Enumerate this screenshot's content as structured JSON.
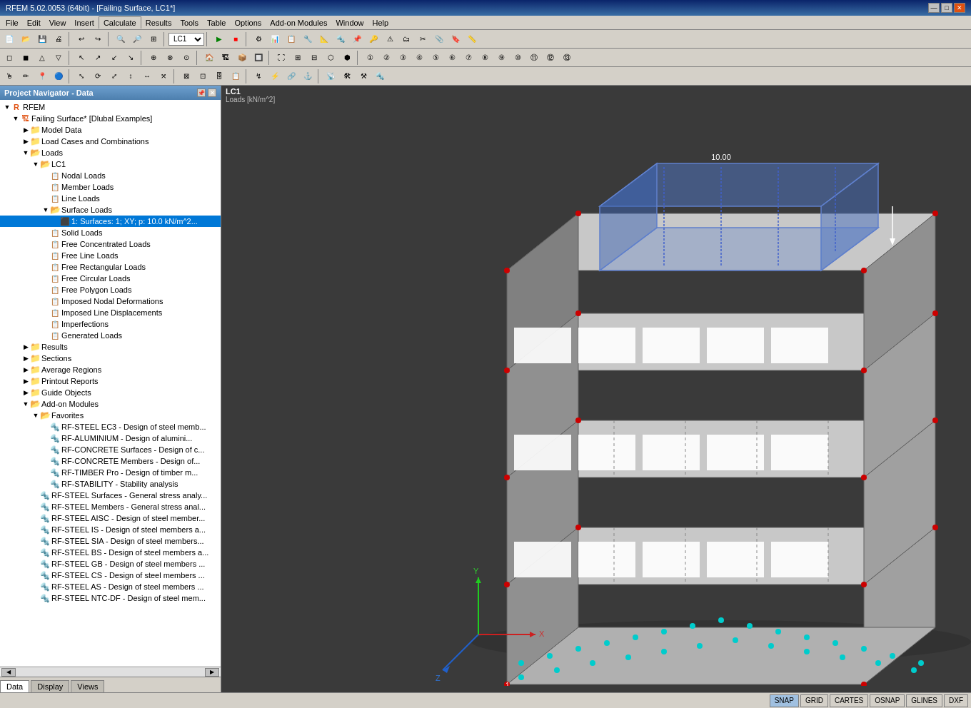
{
  "titlebar": {
    "title": "RFEM 5.02.0053 (64bit) - [Failing Surface, LC1*]",
    "controls": [
      "—",
      "□",
      "✕"
    ]
  },
  "menubar": {
    "items": [
      "File",
      "Edit",
      "View",
      "Insert",
      "Calculate",
      "Results",
      "Tools",
      "Table",
      "Options",
      "Add-on Modules",
      "Window",
      "Help"
    ]
  },
  "toolbar": {
    "lc_value": "LC1"
  },
  "nav": {
    "title": "Project Navigator - Data",
    "tabs": [
      "Data",
      "Display",
      "Views"
    ]
  },
  "tree": {
    "root": "RFEM",
    "project": "Failing Surface* [Dlubal Examples]",
    "nodes": [
      {
        "id": "model-data",
        "label": "Model Data",
        "level": 1,
        "type": "folder",
        "expanded": false
      },
      {
        "id": "load-cases",
        "label": "Load Cases and Combinations",
        "level": 1,
        "type": "folder",
        "expanded": false
      },
      {
        "id": "loads",
        "label": "Loads",
        "level": 1,
        "type": "folder",
        "expanded": true
      },
      {
        "id": "lc1",
        "label": "LC1",
        "level": 2,
        "type": "folder",
        "expanded": true
      },
      {
        "id": "nodal-loads",
        "label": "Nodal Loads",
        "level": 3,
        "type": "item"
      },
      {
        "id": "member-loads",
        "label": "Member Loads",
        "level": 3,
        "type": "item"
      },
      {
        "id": "line-loads",
        "label": "Line Loads",
        "level": 3,
        "type": "item"
      },
      {
        "id": "surface-loads",
        "label": "Surface Loads",
        "level": 3,
        "type": "folder",
        "expanded": true
      },
      {
        "id": "surface-load-1",
        "label": "1: Surfaces: 1; XY; p: 10.0 kN/m^2...",
        "level": 4,
        "type": "load-item"
      },
      {
        "id": "solid-loads",
        "label": "Solid Loads",
        "level": 3,
        "type": "item"
      },
      {
        "id": "free-conc-loads",
        "label": "Free Concentrated Loads",
        "level": 3,
        "type": "item"
      },
      {
        "id": "free-line-loads",
        "label": "Free Line Loads",
        "level": 3,
        "type": "item"
      },
      {
        "id": "free-rect-loads",
        "label": "Free Rectangular Loads",
        "level": 3,
        "type": "item"
      },
      {
        "id": "free-circ-loads",
        "label": "Free Circular Loads",
        "level": 3,
        "type": "item"
      },
      {
        "id": "free-poly-loads",
        "label": "Free Polygon Loads",
        "level": 3,
        "type": "item"
      },
      {
        "id": "imposed-nodal",
        "label": "Imposed Nodal Deformations",
        "level": 3,
        "type": "item"
      },
      {
        "id": "imposed-line",
        "label": "Imposed Line Displacements",
        "level": 3,
        "type": "item"
      },
      {
        "id": "imperfections",
        "label": "Imperfections",
        "level": 3,
        "type": "item"
      },
      {
        "id": "generated-loads",
        "label": "Generated Loads",
        "level": 3,
        "type": "item"
      },
      {
        "id": "results",
        "label": "Results",
        "level": 1,
        "type": "folder",
        "expanded": false
      },
      {
        "id": "sections",
        "label": "Sections",
        "level": 1,
        "type": "folder",
        "expanded": false
      },
      {
        "id": "average-regions",
        "label": "Average Regions",
        "level": 1,
        "type": "folder",
        "expanded": false
      },
      {
        "id": "printout",
        "label": "Printout Reports",
        "level": 1,
        "type": "folder",
        "expanded": false
      },
      {
        "id": "guide-objects",
        "label": "Guide Objects",
        "level": 1,
        "type": "folder",
        "expanded": false
      },
      {
        "id": "addon-modules",
        "label": "Add-on Modules",
        "level": 1,
        "type": "folder",
        "expanded": true
      },
      {
        "id": "favorites",
        "label": "Favorites",
        "level": 2,
        "type": "folder",
        "expanded": true
      },
      {
        "id": "rf-steel-ec3",
        "label": "RF-STEEL EC3 - Design of steel memb...",
        "level": 3,
        "type": "addon"
      },
      {
        "id": "rf-aluminium",
        "label": "RF-ALUMINIUM - Design of alumini...",
        "level": 3,
        "type": "addon"
      },
      {
        "id": "rf-concrete-surfaces",
        "label": "RF-CONCRETE Surfaces - Design of c...",
        "level": 3,
        "type": "addon"
      },
      {
        "id": "rf-concrete-members",
        "label": "RF-CONCRETE Members - Design of...",
        "level": 3,
        "type": "addon"
      },
      {
        "id": "rf-timber-pro",
        "label": "RF-TIMBER Pro - Design of timber m...",
        "level": 3,
        "type": "addon"
      },
      {
        "id": "rf-stability",
        "label": "RF-STABILITY - Stability analysis",
        "level": 3,
        "type": "addon"
      },
      {
        "id": "rf-steel-surfaces",
        "label": "RF-STEEL Surfaces - General stress analy...",
        "level": 2,
        "type": "addon"
      },
      {
        "id": "rf-steel-members",
        "label": "RF-STEEL Members - General stress anal...",
        "level": 2,
        "type": "addon"
      },
      {
        "id": "rf-steel-aisc",
        "label": "RF-STEEL AISC - Design of steel member...",
        "level": 2,
        "type": "addon"
      },
      {
        "id": "rf-steel-is",
        "label": "RF-STEEL IS - Design of steel members a...",
        "level": 2,
        "type": "addon"
      },
      {
        "id": "rf-steel-sia",
        "label": "RF-STEEL SIA - Design of steel members...",
        "level": 2,
        "type": "addon"
      },
      {
        "id": "rf-steel-bs",
        "label": "RF-STEEL BS - Design of steel members a...",
        "level": 2,
        "type": "addon"
      },
      {
        "id": "rf-steel-gb",
        "label": "RF-STEEL GB - Design of steel members ...",
        "level": 2,
        "type": "addon"
      },
      {
        "id": "rf-steel-cs",
        "label": "RF-STEEL CS - Design of steel members ...",
        "level": 2,
        "type": "addon"
      },
      {
        "id": "rf-steel-as",
        "label": "RF-STEEL AS - Design of steel members ...",
        "level": 2,
        "type": "addon"
      },
      {
        "id": "rf-steel-ntc",
        "label": "RF-STEEL NTC-DF - Design of steel mem...",
        "level": 2,
        "type": "addon"
      }
    ]
  },
  "viewport": {
    "label": "LC1",
    "sublabel": "Loads [kN/m^2]"
  },
  "statusbar": {
    "buttons": [
      "SNAP",
      "GRID",
      "CARTES",
      "OSNAP",
      "GLINES",
      "DXF"
    ]
  }
}
